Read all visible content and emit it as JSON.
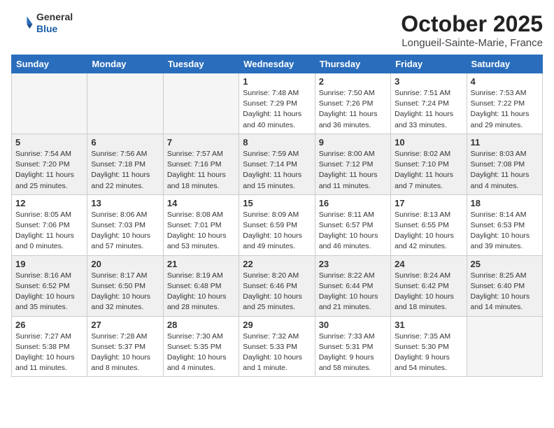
{
  "header": {
    "logo_general": "General",
    "logo_blue": "Blue",
    "month_title": "October 2025",
    "location": "Longueil-Sainte-Marie, France"
  },
  "weekdays": [
    "Sunday",
    "Monday",
    "Tuesday",
    "Wednesday",
    "Thursday",
    "Friday",
    "Saturday"
  ],
  "weeks": [
    [
      {
        "day": "",
        "info": ""
      },
      {
        "day": "",
        "info": ""
      },
      {
        "day": "",
        "info": ""
      },
      {
        "day": "1",
        "info": "Sunrise: 7:48 AM\nSunset: 7:29 PM\nDaylight: 11 hours\nand 40 minutes."
      },
      {
        "day": "2",
        "info": "Sunrise: 7:50 AM\nSunset: 7:26 PM\nDaylight: 11 hours\nand 36 minutes."
      },
      {
        "day": "3",
        "info": "Sunrise: 7:51 AM\nSunset: 7:24 PM\nDaylight: 11 hours\nand 33 minutes."
      },
      {
        "day": "4",
        "info": "Sunrise: 7:53 AM\nSunset: 7:22 PM\nDaylight: 11 hours\nand 29 minutes."
      }
    ],
    [
      {
        "day": "5",
        "info": "Sunrise: 7:54 AM\nSunset: 7:20 PM\nDaylight: 11 hours\nand 25 minutes."
      },
      {
        "day": "6",
        "info": "Sunrise: 7:56 AM\nSunset: 7:18 PM\nDaylight: 11 hours\nand 22 minutes."
      },
      {
        "day": "7",
        "info": "Sunrise: 7:57 AM\nSunset: 7:16 PM\nDaylight: 11 hours\nand 18 minutes."
      },
      {
        "day": "8",
        "info": "Sunrise: 7:59 AM\nSunset: 7:14 PM\nDaylight: 11 hours\nand 15 minutes."
      },
      {
        "day": "9",
        "info": "Sunrise: 8:00 AM\nSunset: 7:12 PM\nDaylight: 11 hours\nand 11 minutes."
      },
      {
        "day": "10",
        "info": "Sunrise: 8:02 AM\nSunset: 7:10 PM\nDaylight: 11 hours\nand 7 minutes."
      },
      {
        "day": "11",
        "info": "Sunrise: 8:03 AM\nSunset: 7:08 PM\nDaylight: 11 hours\nand 4 minutes."
      }
    ],
    [
      {
        "day": "12",
        "info": "Sunrise: 8:05 AM\nSunset: 7:06 PM\nDaylight: 11 hours\nand 0 minutes."
      },
      {
        "day": "13",
        "info": "Sunrise: 8:06 AM\nSunset: 7:03 PM\nDaylight: 10 hours\nand 57 minutes."
      },
      {
        "day": "14",
        "info": "Sunrise: 8:08 AM\nSunset: 7:01 PM\nDaylight: 10 hours\nand 53 minutes."
      },
      {
        "day": "15",
        "info": "Sunrise: 8:09 AM\nSunset: 6:59 PM\nDaylight: 10 hours\nand 49 minutes."
      },
      {
        "day": "16",
        "info": "Sunrise: 8:11 AM\nSunset: 6:57 PM\nDaylight: 10 hours\nand 46 minutes."
      },
      {
        "day": "17",
        "info": "Sunrise: 8:13 AM\nSunset: 6:55 PM\nDaylight: 10 hours\nand 42 minutes."
      },
      {
        "day": "18",
        "info": "Sunrise: 8:14 AM\nSunset: 6:53 PM\nDaylight: 10 hours\nand 39 minutes."
      }
    ],
    [
      {
        "day": "19",
        "info": "Sunrise: 8:16 AM\nSunset: 6:52 PM\nDaylight: 10 hours\nand 35 minutes."
      },
      {
        "day": "20",
        "info": "Sunrise: 8:17 AM\nSunset: 6:50 PM\nDaylight: 10 hours\nand 32 minutes."
      },
      {
        "day": "21",
        "info": "Sunrise: 8:19 AM\nSunset: 6:48 PM\nDaylight: 10 hours\nand 28 minutes."
      },
      {
        "day": "22",
        "info": "Sunrise: 8:20 AM\nSunset: 6:46 PM\nDaylight: 10 hours\nand 25 minutes."
      },
      {
        "day": "23",
        "info": "Sunrise: 8:22 AM\nSunset: 6:44 PM\nDaylight: 10 hours\nand 21 minutes."
      },
      {
        "day": "24",
        "info": "Sunrise: 8:24 AM\nSunset: 6:42 PM\nDaylight: 10 hours\nand 18 minutes."
      },
      {
        "day": "25",
        "info": "Sunrise: 8:25 AM\nSunset: 6:40 PM\nDaylight: 10 hours\nand 14 minutes."
      }
    ],
    [
      {
        "day": "26",
        "info": "Sunrise: 7:27 AM\nSunset: 5:38 PM\nDaylight: 10 hours\nand 11 minutes."
      },
      {
        "day": "27",
        "info": "Sunrise: 7:28 AM\nSunset: 5:37 PM\nDaylight: 10 hours\nand 8 minutes."
      },
      {
        "day": "28",
        "info": "Sunrise: 7:30 AM\nSunset: 5:35 PM\nDaylight: 10 hours\nand 4 minutes."
      },
      {
        "day": "29",
        "info": "Sunrise: 7:32 AM\nSunset: 5:33 PM\nDaylight: 10 hours\nand 1 minute."
      },
      {
        "day": "30",
        "info": "Sunrise: 7:33 AM\nSunset: 5:31 PM\nDaylight: 9 hours\nand 58 minutes."
      },
      {
        "day": "31",
        "info": "Sunrise: 7:35 AM\nSunset: 5:30 PM\nDaylight: 9 hours\nand 54 minutes."
      },
      {
        "day": "",
        "info": ""
      }
    ]
  ]
}
